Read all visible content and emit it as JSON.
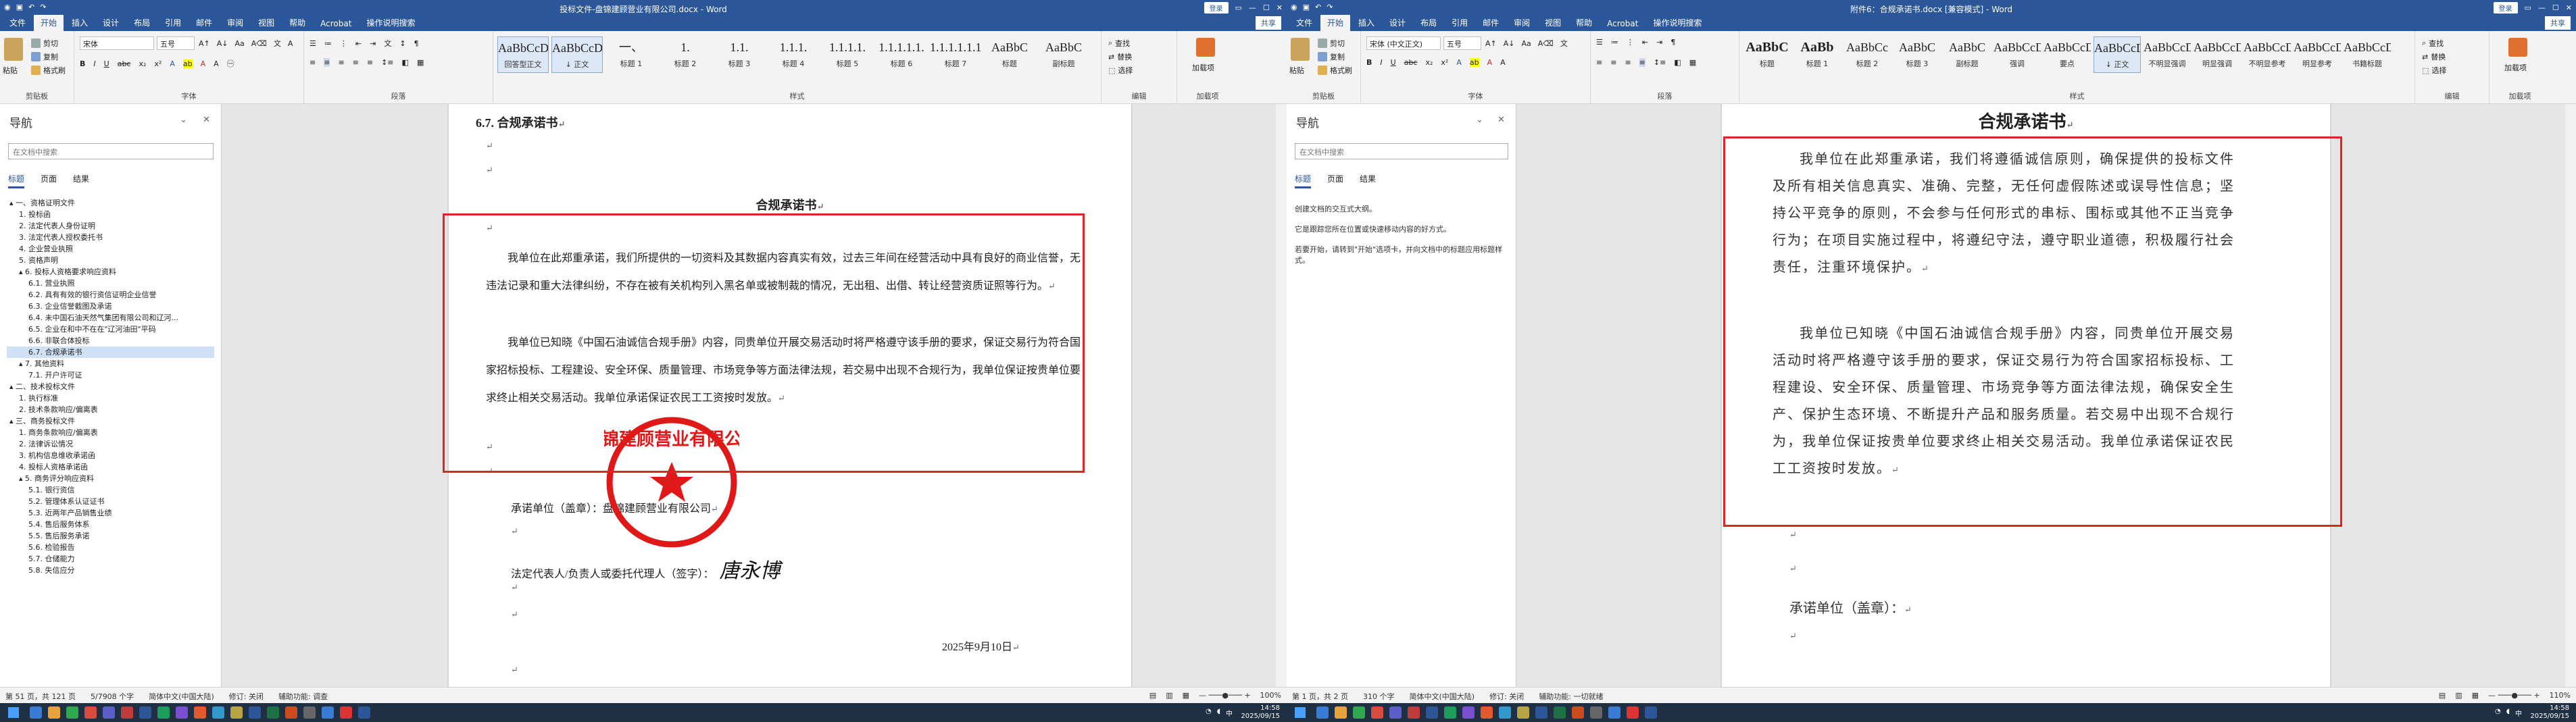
{
  "left": {
    "title": "投标文件-盘锦建顾营业有限公司.docx - Word",
    "login": "登录",
    "share": "共享",
    "tabs": [
      "文件",
      "开始",
      "插入",
      "设计",
      "布局",
      "引用",
      "邮件",
      "审阅",
      "视图",
      "帮助",
      "Acrobat",
      "操作说明搜索"
    ],
    "clipboard": {
      "paste": "粘贴",
      "cut": "剪切",
      "copy": "复制",
      "format": "格式刷",
      "label": "剪贴板"
    },
    "font": {
      "name": "宋体",
      "size": "五号",
      "label": "字体"
    },
    "paragraph_label": "段落",
    "styles": [
      {
        "preview": "AaBbCcDd",
        "name": "回答型正文"
      },
      {
        "preview": "AaBbCcDd",
        "name": "↓ 正文"
      },
      {
        "preview": "一、",
        "name": "标题 1"
      },
      {
        "preview": "1.",
        "name": "标题 2"
      },
      {
        "preview": "1.1.",
        "name": "标题 3"
      },
      {
        "preview": "1.1.1.",
        "name": "标题 4"
      },
      {
        "preview": "1.1.1.1.",
        "name": "标题 5"
      },
      {
        "preview": "1.1.1.1.1.",
        "name": "标题 6"
      },
      {
        "preview": "1.1.1.1.1.1",
        "name": "标题 7"
      },
      {
        "preview": "AaBbC",
        "name": "标题"
      },
      {
        "preview": "AaBbC",
        "name": "副标题"
      }
    ],
    "styles_label": "样式",
    "edit": {
      "find": "查找",
      "replace": "替换",
      "select": "选择",
      "label": "编辑"
    },
    "addin": {
      "name": "加载项",
      "label": "加载项"
    },
    "nav": {
      "header": "导航",
      "search_placeholder": "在文档中搜索",
      "tabs": [
        "标题",
        "页面",
        "结果"
      ],
      "tree": [
        {
          "t": "▴ 一、资格证明文件",
          "lv": 0,
          "sel": false
        },
        {
          "t": "1. 投标函",
          "lv": 1,
          "sel": false
        },
        {
          "t": "2. 法定代表人身份证明",
          "lv": 1,
          "sel": false
        },
        {
          "t": "3. 法定代表人授权委托书",
          "lv": 1,
          "sel": false
        },
        {
          "t": "4. 企业营业执照",
          "lv": 1,
          "sel": false
        },
        {
          "t": "5. 资格声明",
          "lv": 1,
          "sel": false
        },
        {
          "t": "▴ 6. 投标人资格要求响应资料",
          "lv": 1,
          "sel": false
        },
        {
          "t": "6.1. 营业执照",
          "lv": 2,
          "sel": false
        },
        {
          "t": "6.2. 具有有效的银行资信证明企业信誉",
          "lv": 2,
          "sel": false
        },
        {
          "t": "6.3. 企业信誉截图及承诺",
          "lv": 2,
          "sel": false
        },
        {
          "t": "6.4. 未中国石油天然气集团有限公司和辽河...",
          "lv": 2,
          "sel": false
        },
        {
          "t": "6.5. 企业在和中不在在\"辽河油田\"平码",
          "lv": 2,
          "sel": false
        },
        {
          "t": "6.6. 非联合体投标",
          "lv": 2,
          "sel": false
        },
        {
          "t": "6.7. 合规承诺书",
          "lv": 2,
          "sel": true
        },
        {
          "t": "▴ 7. 其他资料",
          "lv": 1,
          "sel": false
        },
        {
          "t": "7.1. 开户许可证",
          "lv": 2,
          "sel": false
        },
        {
          "t": "▴ 二、技术投标文件",
          "lv": 0,
          "sel": false
        },
        {
          "t": "1. 执行标准",
          "lv": 1,
          "sel": false
        },
        {
          "t": "2. 技术条款响应/偏离表",
          "lv": 1,
          "sel": false
        },
        {
          "t": "▴ 三、商务投标文件",
          "lv": 0,
          "sel": false
        },
        {
          "t": "1. 商务条款响应/偏离表",
          "lv": 1,
          "sel": false
        },
        {
          "t": "2. 法律诉讼情况",
          "lv": 1,
          "sel": false
        },
        {
          "t": "3. 机构信息维收承诺函",
          "lv": 1,
          "sel": false
        },
        {
          "t": "4. 投标人资格承诺函",
          "lv": 1,
          "sel": false
        },
        {
          "t": "▴ 5. 商务评分响应资料",
          "lv": 1,
          "sel": false
        },
        {
          "t": "5.1. 银行资信",
          "lv": 2,
          "sel": false
        },
        {
          "t": "5.2. 管理体系认证证书",
          "lv": 2,
          "sel": false
        },
        {
          "t": "5.3. 近两年产品销售业绩",
          "lv": 2,
          "sel": false
        },
        {
          "t": "5.4. 售后服务体系",
          "lv": 2,
          "sel": false
        },
        {
          "t": "5.5. 售后服务承诺",
          "lv": 2,
          "sel": false
        },
        {
          "t": "5.6. 检验报告",
          "lv": 2,
          "sel": false
        },
        {
          "t": "5.7. 仓储能力",
          "lv": 2,
          "sel": false
        },
        {
          "t": "5.8. 失信应分",
          "lv": 2,
          "sel": false
        }
      ]
    },
    "doc": {
      "heading": "6.7. 合规承诺书",
      "title": "合规承诺书",
      "para1": "我单位在此郑重承诺，我们所提供的一切资料及其数据内容真实有效，过去三年间在经营活动中具有良好的商业信誉，无违法记录和重大法律纠纷，不存在被有关机构列入黑名单或被制裁的情况，无出租、出借、转让经营资质证照等行为。",
      "para2": "我单位已知晓《中国石油诚信合规手册》内容，同贵单位开展交易活动时将严格遵守该手册的要求，保证交易行为符合国家招标投标、工程建设、安全环保、质量管理、市场竞争等方面法律法规，若交易中出现不合规行为，我单位保证按贵单位要求终止相关交易活动。我单位承诺保证农民工工资按时发放。",
      "seal_line": "承诺单位（盖章）：盘锦建顾营业有限公司",
      "sign_line": "法定代表人/负责人或委托代理人（签字）：",
      "signature": "唐永博",
      "date": "2025年9月10日",
      "stamp_text": "盘锦建顾营业有限公司"
    },
    "status": {
      "page": "第 51 页，共 121 页",
      "words": "5/7908 个字",
      "lang": "简体中文(中国大陆)",
      "track": "修订: 关闭",
      "access": "辅助功能: 调查",
      "zoom": "100%"
    }
  },
  "right": {
    "title": "附件6：合规承诺书.docx [兼容模式] - Word",
    "login": "登录",
    "share": "共享",
    "tabs": [
      "文件",
      "开始",
      "插入",
      "设计",
      "布局",
      "引用",
      "邮件",
      "审阅",
      "视图",
      "帮助",
      "Acrobat",
      "操作说明搜索"
    ],
    "font": {
      "name": "宋体 (中文正文)",
      "size": "五号",
      "label": "字体"
    },
    "styles": [
      {
        "preview": "AaBbC",
        "name": "标题"
      },
      {
        "preview": "AaBb",
        "name": "标题 1"
      },
      {
        "preview": "AaBbCc",
        "name": "标题 2"
      },
      {
        "preview": "AaBbC",
        "name": "标题 3"
      },
      {
        "preview": "AaBbC",
        "name": "副标题"
      },
      {
        "preview": "AaBbCcDd",
        "name": "强调"
      },
      {
        "preview": "AaBbCcDd",
        "name": "要点"
      },
      {
        "preview": "AaBbCcDd",
        "name": "↓ 正文"
      },
      {
        "preview": "AaBbCcDd",
        "name": "不明显强调"
      },
      {
        "preview": "AaBbCcDd",
        "name": "明显强调"
      },
      {
        "preview": "AaBbCcDd",
        "name": "不明显参考"
      },
      {
        "preview": "AaBbCcDd",
        "name": "明显参考"
      },
      {
        "preview": "AaBbCcDd",
        "name": "书籍标题"
      }
    ],
    "nav": {
      "header": "导航",
      "search_placeholder": "在文档中搜索",
      "tabs": [
        "标题",
        "页面",
        "结果"
      ],
      "msg1": "创建文档的交互式大纲。",
      "msg2": "它是跟踪您所在位置或快速移动内容的好方式。",
      "msg3": "若要开始，请转到\"开始\"选项卡，并向文档中的标题应用标题样式。"
    },
    "doc": {
      "title": "合规承诺书",
      "para1": "我单位在此郑重承诺，我们将遵循诚信原则，确保提供的投标文件及所有相关信息真实、准确、完整，无任何虚假陈述或误导性信息；坚持公平竞争的原则，不会参与任何形式的串标、围标或其他不正当竞争行为；在项目实施过程中，将遵纪守法，遵守职业道德，积极履行社会责任，注重环境保护。",
      "para2": "我单位已知晓《中国石油诚信合规手册》内容，同贵单位开展交易活动时将严格遵守该手册的要求，保证交易行为符合国家招标投标、工程建设、安全环保、质量管理、市场竞争等方面法律法规，确保安全生产、保护生态环境、不断提升产品和服务质量。若交易中出现不合规行为，我单位保证按贵单位要求终止相关交易活动。我单位承诺保证农民工工资按时发放。",
      "seal_line": "承诺单位（盖章）："
    },
    "status": {
      "page": "第 1 页，共 2 页",
      "words": "310 个字",
      "lang": "简体中文(中国大陆)",
      "track": "修订: 关闭",
      "access": "辅助功能: 一切就绪",
      "zoom": "110%"
    }
  },
  "taskbar": {
    "time": "14:58",
    "date": "2025/09/15"
  }
}
